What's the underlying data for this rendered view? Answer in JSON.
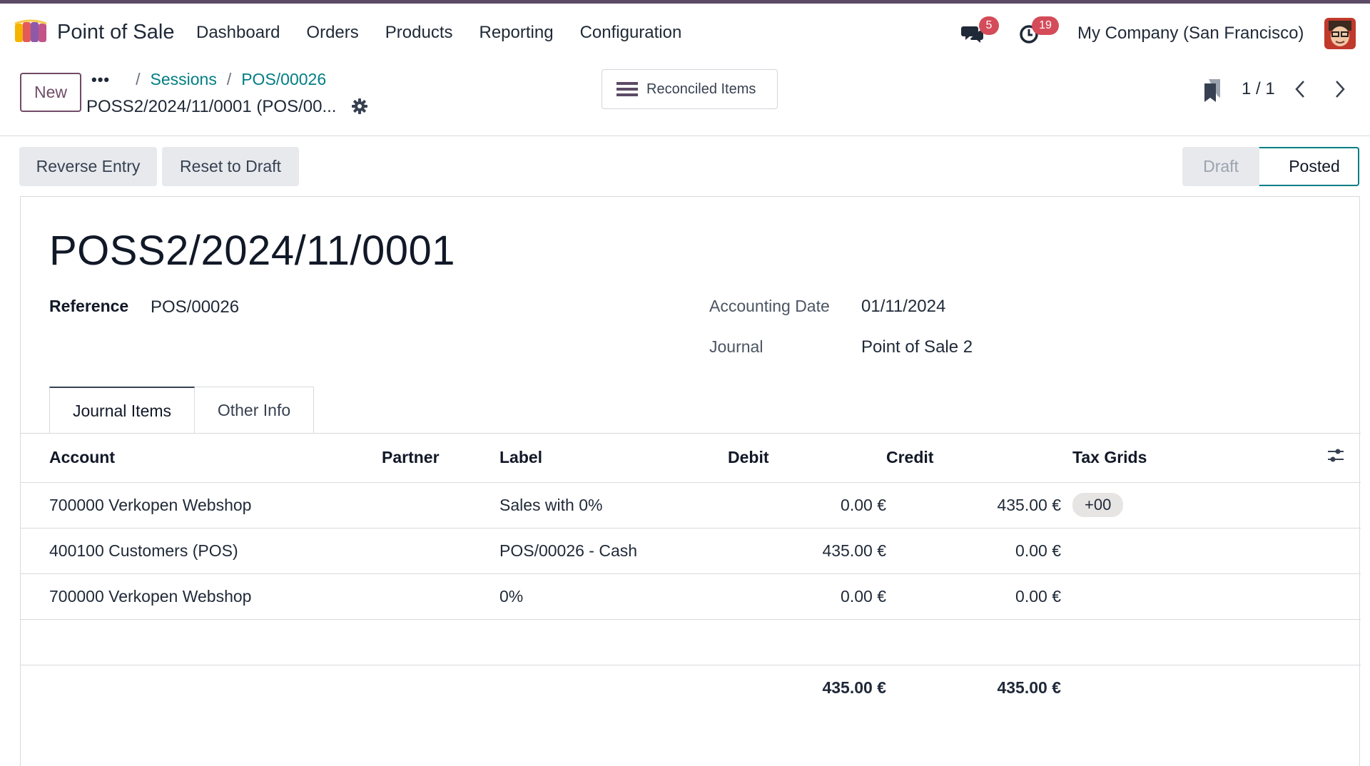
{
  "navbar": {
    "app_name": "Point of Sale",
    "menu": [
      "Dashboard",
      "Orders",
      "Products",
      "Reporting",
      "Configuration"
    ],
    "messages_count": "5",
    "activities_count": "19",
    "company": "My Company (San Francisco)"
  },
  "control": {
    "new_label": "New",
    "breadcrumb_dots": "•••",
    "breadcrumb": [
      "Sessions",
      "POS/00026"
    ],
    "record_title": "POSS2/2024/11/0001 (POS/00...",
    "reconciled_label": "Reconciled Items",
    "pager": "1 / 1"
  },
  "actions": {
    "reverse_entry": "Reverse Entry",
    "reset_to_draft": "Reset to Draft"
  },
  "status": {
    "stages": [
      "Draft",
      "Posted"
    ],
    "current": "Posted"
  },
  "form": {
    "name": "POSS2/2024/11/0001",
    "reference_label": "Reference",
    "reference_value": "POS/00026",
    "accounting_date_label": "Accounting Date",
    "accounting_date_value": "01/11/2024",
    "journal_label": "Journal",
    "journal_value": "Point of Sale 2"
  },
  "tabs": [
    "Journal Items",
    "Other Info"
  ],
  "journal_items": {
    "columns": [
      "Account",
      "Partner",
      "Label",
      "Debit",
      "Credit",
      "Tax Grids"
    ],
    "rows": [
      {
        "account": "700000 Verkopen Webshop",
        "partner": "",
        "label": "Sales with 0%",
        "debit": "0.00 €",
        "credit": "435.00 €",
        "tax_grid": "+00"
      },
      {
        "account": "400100 Customers (POS)",
        "partner": "",
        "label": "POS/00026 - Cash",
        "debit": "435.00 €",
        "credit": "0.00 €",
        "tax_grid": ""
      },
      {
        "account": "700000 Verkopen Webshop",
        "partner": "",
        "label": "0%",
        "debit": "0.00 €",
        "credit": "0.00 €",
        "tax_grid": ""
      }
    ],
    "total_debit": "435.00 €",
    "total_credit": "435.00 €"
  },
  "colors": {
    "brand": "#714b67",
    "link": "#017e84",
    "badge": "#d44c59"
  }
}
